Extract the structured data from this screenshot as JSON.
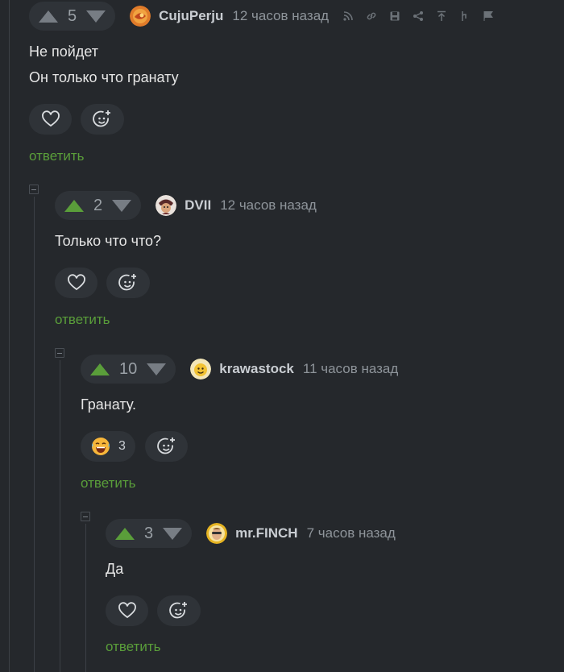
{
  "comments": [
    {
      "votes": "5",
      "user": "CujuPerju",
      "time": "12 часов назад",
      "lines": [
        "Не пойдет",
        "Он только что гранату"
      ],
      "reply": "ответить"
    },
    {
      "votes": "2",
      "user": "DVII",
      "time": "12 часов назад",
      "lines": [
        "Только что что?"
      ],
      "reply": "ответить"
    },
    {
      "votes": "10",
      "user": "krawastock",
      "time": "11 часов назад",
      "lines": [
        "Гранату."
      ],
      "reaction_count": "3",
      "reply": "ответить"
    },
    {
      "votes": "3",
      "user": "mr.FINCH",
      "time": "7 часов назад",
      "lines": [
        "Да"
      ],
      "reply": "ответить"
    }
  ],
  "toolbar_icons": [
    "rss-icon",
    "link-icon",
    "save-icon",
    "share-icon",
    "go-up-icon",
    "branch-icon",
    "report-flag-icon"
  ],
  "colors": {
    "background": "#25282c",
    "pill": "#2f3338",
    "accent_green": "#5a9e3a",
    "muted": "#8e949a"
  }
}
